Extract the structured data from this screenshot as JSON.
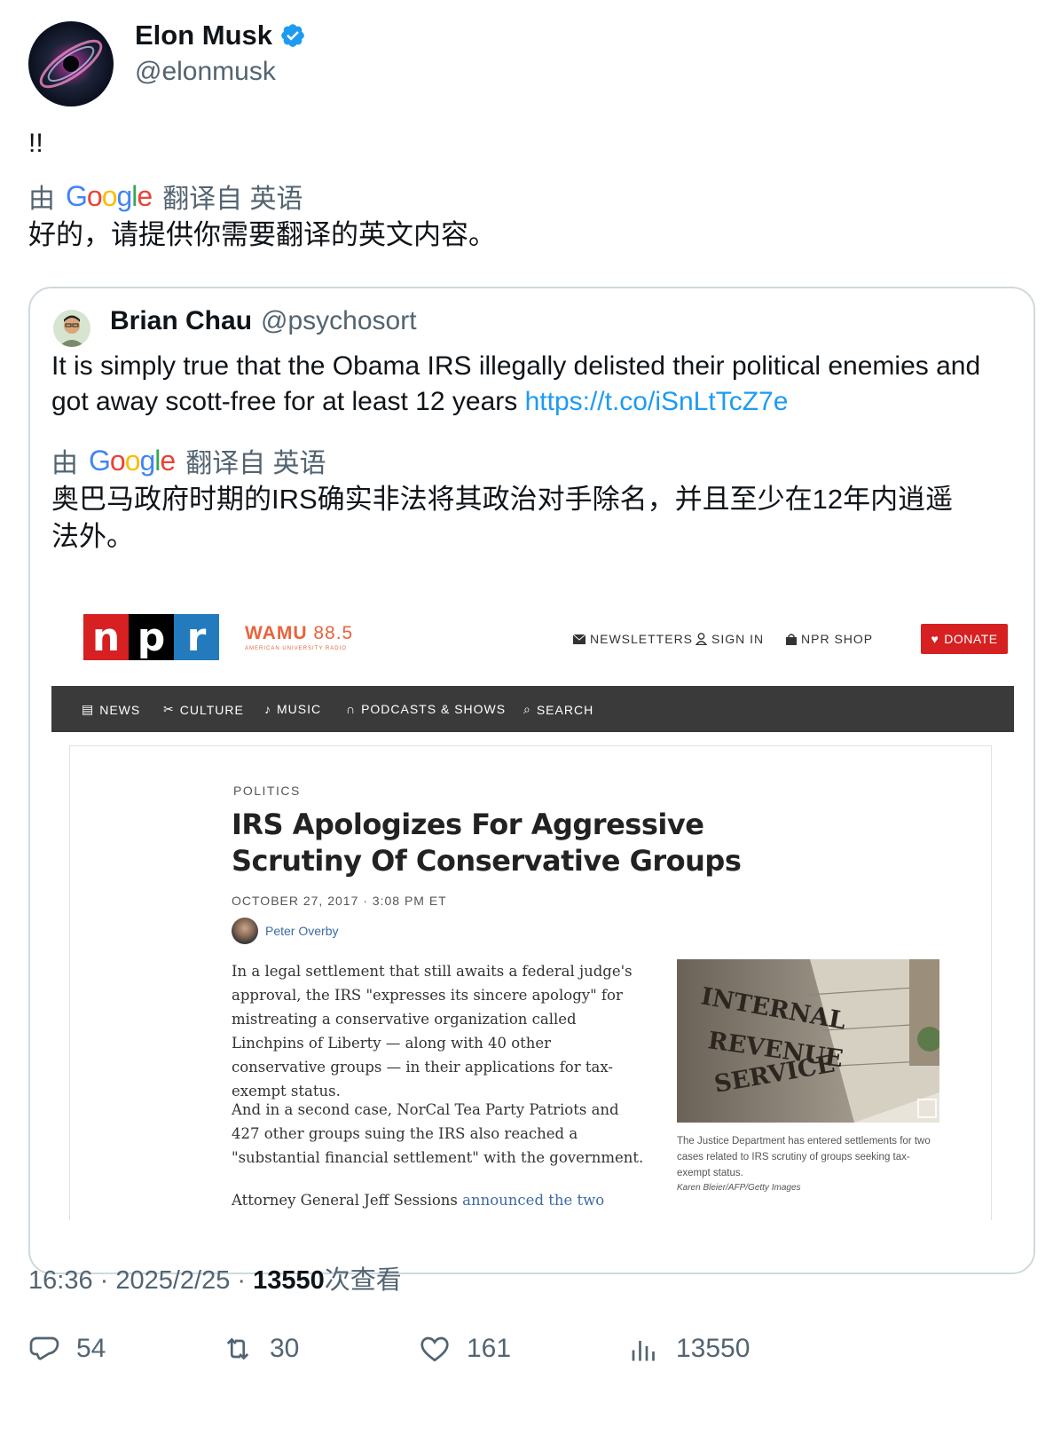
{
  "author": {
    "name": "Elon Musk",
    "handle": "@elonmusk"
  },
  "tweet": {
    "text": "!!",
    "translated_text": "好的，请提供你需要翻译的英文内容。"
  },
  "translation": {
    "by": "由",
    "engine": "Google",
    "from_label": "翻译自 英语"
  },
  "quote": {
    "name": "Brian Chau",
    "handle": "@psychosort",
    "text": "It is simply true that the Obama IRS illegally delisted their political enemies and got away scott-free for at least 12 years ",
    "link": "https://t.co/iSnLtTcZ7e",
    "translated_text": "奥巴马政府时期的IRS确实非法将其政治对手除名，并且至少在12年内逍遥法外。"
  },
  "article_screenshot": {
    "brand_letters": [
      "n",
      "p",
      "r"
    ],
    "station": "WAMU",
    "station_freq": "88.5",
    "station_sub": "AMERICAN UNIVERSITY RADIO",
    "top_nav": [
      "NEWSLETTERS",
      "SIGN IN",
      "NPR SHOP"
    ],
    "donate": "DONATE",
    "main_nav": [
      "NEWS",
      "CULTURE",
      "MUSIC",
      "PODCASTS & SHOWS",
      "SEARCH"
    ],
    "section": "POLITICS",
    "headline": "IRS Apologizes For Aggressive Scrutiny Of Conservative Groups",
    "date": "OCTOBER 27, 2017 · 3:08 PM ET",
    "author": "Peter Overby",
    "paragraphs": [
      "In a legal settlement that still awaits a federal judge's approval, the IRS \"expresses its sincere apology\" for mistreating a conservative organization called Linchpins of Liberty — along with 40 other conservative groups — in their applications for tax-exempt status.",
      "And in a second case, NorCal Tea Party Patriots and 427 other groups suing the IRS also reached a \"substantial financial settlement\" with the government."
    ],
    "para3_prefix": "Attorney General Jeff Sessions ",
    "para3_link": "announced the two",
    "image_words": [
      "INTERNAL",
      "REVENUE",
      "SERVICE"
    ],
    "caption": "The Justice Department has entered settlements for two cases related to IRS scrutiny of groups seeking tax-exempt status.",
    "credit": "Karen Bleier/AFP/Getty Images"
  },
  "meta": {
    "time": "16:36 · 2025/2/25 · ",
    "views": "13550",
    "views_label": "次查看"
  },
  "actions": {
    "replies": "54",
    "retweets": "30",
    "likes": "161",
    "views": "13550"
  },
  "colors": {
    "link": "#1d9bf0",
    "secondary": "#536471",
    "npr_red": "#d62021",
    "npr_blue": "#237bbd"
  }
}
